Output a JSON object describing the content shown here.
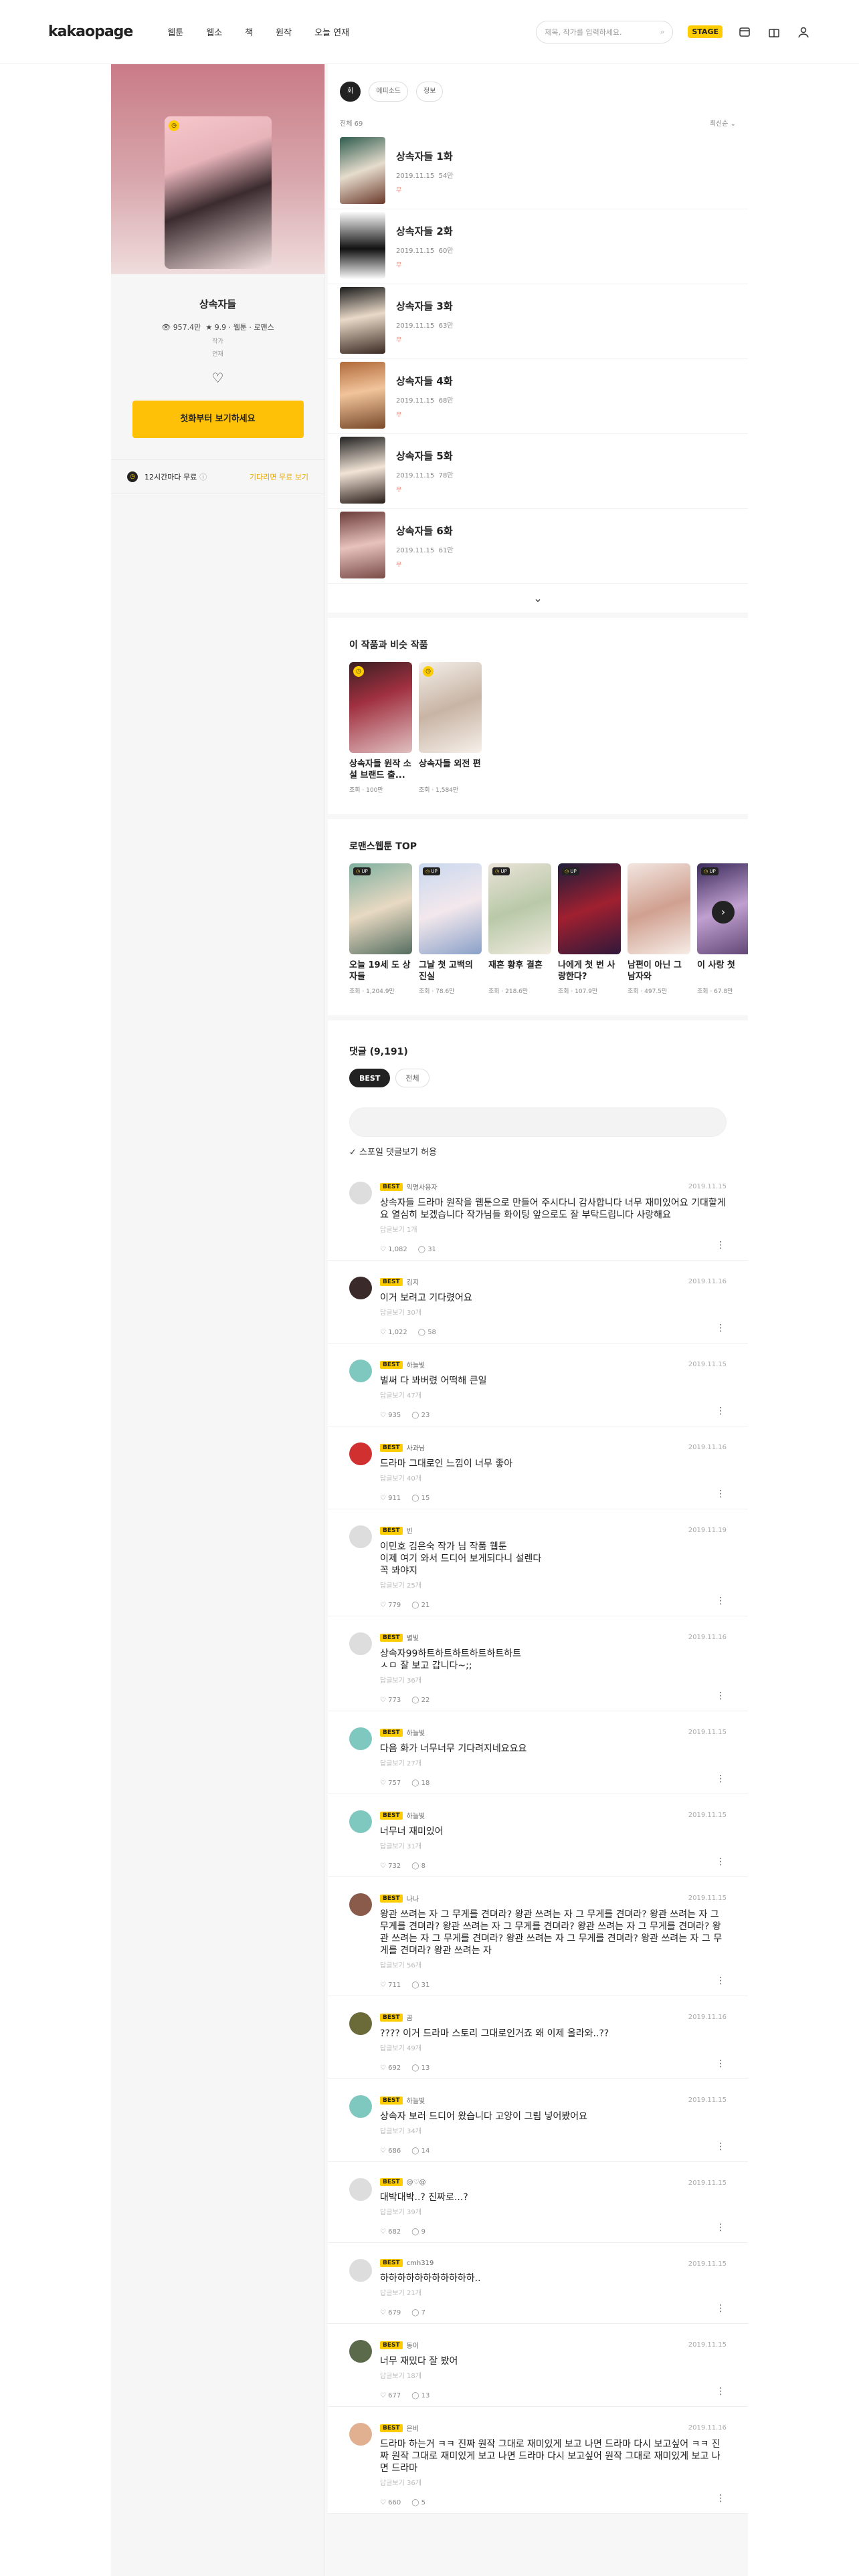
{
  "header": {
    "logo": "kakaopage",
    "nav": [
      "웹툰",
      "웹소",
      "책",
      "원작",
      "오늘 연재"
    ],
    "search_placeholder": "제목, 작가를 입력하세요.",
    "stage": "STAGE"
  },
  "work": {
    "title": "상속자들",
    "views": "957.4만",
    "rating": "9.9",
    "meta": "웹툰 · 로맨스",
    "small1": "작가",
    "small2": "연재",
    "read_button": "첫화부터 보기하세요",
    "wait_text": "12시간마다 무료",
    "wait_link": "기다리면 무료 보기"
  },
  "tabs": [
    "회",
    "에피소드",
    "정보"
  ],
  "episode_header": {
    "count": "전체 69",
    "sort": "최신순"
  },
  "episodes": [
    {
      "title": "상속자들 1화",
      "date": "2019.11.15",
      "views": "54만",
      "zero": "무"
    },
    {
      "title": "상속자들 2화",
      "date": "2019.11.15",
      "views": "60만",
      "zero": "무"
    },
    {
      "title": "상속자들 3화",
      "date": "2019.11.15",
      "views": "63만",
      "zero": "무"
    },
    {
      "title": "상속자들 4화",
      "date": "2019.11.15",
      "views": "68만",
      "zero": "무"
    },
    {
      "title": "상속자들 5화",
      "date": "2019.11.15",
      "views": "78만",
      "zero": "무"
    },
    {
      "title": "상속자들 6화",
      "date": "2019.11.15",
      "views": "61만",
      "zero": "무"
    }
  ],
  "related": {
    "title": "이 작품과 비슷 작품",
    "cards": [
      {
        "title": "상속자들 원작 소설 브랜드 출...",
        "views": "조회 · 100만"
      },
      {
        "title": "상속자들 외전 편",
        "views": "조회 · 1,584만"
      }
    ]
  },
  "top": {
    "title": "로맨스웹툰 TOP",
    "cards": [
      {
        "title": "오늘 19세 도 상자들",
        "views": "조회 · 1,204.9만"
      },
      {
        "title": "그날 첫 고백의 진실",
        "views": "조회 · 78.6만"
      },
      {
        "title": "재혼 황후 결혼",
        "views": "조회 · 218.6만"
      },
      {
        "title": "나에게 첫 번 사랑한다?",
        "views": "조회 · 107.9만"
      },
      {
        "title": "남편이 아닌 그 남자와",
        "views": "조회 · 497.5만"
      },
      {
        "title": "이 사랑 첫",
        "views": "조회 · 67.8만"
      }
    ]
  },
  "comments_section": {
    "title": "댓글 (9,191)",
    "tab_best": "BEST",
    "tab_all": "전체",
    "spoiler": "스포일 댓글보기 허용"
  },
  "comments": [
    {
      "user": "익명사용자",
      "date": "2019.11.15",
      "text": "상속자들 드라마 원작을 웹툰으로 만들어 주시다니 감사합니다 너무 재미있어요 기대할게요 열심히 보겠습니다 작가님들 화이팅 앞으로도 잘 부탁드립니다 사랑해요",
      "reply": "답글보기 1개",
      "likes": "1,082",
      "replies": "31"
    },
    {
      "user": "김지",
      "date": "2019.11.16",
      "text": "이거 보려고 기다렸어요",
      "reply": "답글보기 30개",
      "likes": "1,022",
      "replies": "58"
    },
    {
      "user": "하늘빛",
      "date": "2019.11.15",
      "text": "벌써 다 봐버렸 어떡해 큰일",
      "reply": "답글보기 47개",
      "likes": "935",
      "replies": "23"
    },
    {
      "user": "사과님",
      "date": "2019.11.16",
      "text": "드라마 그대로인 느낌이 너무 좋아",
      "reply": "답글보기 40개",
      "likes": "911",
      "replies": "15"
    },
    {
      "user": "빈",
      "date": "2019.11.19",
      "text": "이민호 김은숙 작가 님 작품 웹툰\n이제 여기 와서 드디어 보게되다니 설렌다\n꼭 봐야지",
      "reply": "답글보기 25개",
      "likes": "779",
      "replies": "21"
    },
    {
      "user": "별빛",
      "date": "2019.11.16",
      "text": "상속자99하트하트하트하트하트하트\nㅅㅁ 잘 보고 갑니다~;;",
      "reply": "답글보기 36개",
      "likes": "773",
      "replies": "22"
    },
    {
      "user": "하늘빛",
      "date": "2019.11.15",
      "text": "다음 화가 너무너무 기다려지네요요요",
      "reply": "답글보기 27개",
      "likes": "757",
      "replies": "18"
    },
    {
      "user": "하늘빛",
      "date": "2019.11.15",
      "text": "너무너 재미있어",
      "reply": "답글보기 31개",
      "likes": "732",
      "replies": "8"
    },
    {
      "user": "나나",
      "date": "2019.11.15",
      "text": "왕관 쓰려는 자 그 무게를 견뎌라? 왕관 쓰려는 자 그 무게를 견뎌라? 왕관 쓰려는 자 그 무게를 견뎌라? 왕관 쓰려는 자 그 무게를 견뎌라? 왕관 쓰려는 자 그 무게를 견뎌라? 왕관 쓰려는 자 그 무게를 견뎌라? 왕관 쓰려는 자 그 무게를 견뎌라? 왕관 쓰려는 자 그 무게를 견뎌라? 왕관 쓰려는 자",
      "reply": "답글보기 56개",
      "likes": "711",
      "replies": "31"
    },
    {
      "user": "곰",
      "date": "2019.11.16",
      "text": "???? 이거 드라마 스토리 그대로인거죠 왜 이제 올라와..??",
      "reply": "답글보기 49개",
      "likes": "692",
      "replies": "13"
    },
    {
      "user": "하늘빛",
      "date": "2019.11.15",
      "text": "상속자 보러 드디어 왔습니다 고양이 그림 넣어봤어요",
      "reply": "답글보기 34개",
      "likes": "686",
      "replies": "14"
    },
    {
      "user": "@♡@",
      "date": "2019.11.15",
      "text": "대박대박..? 진짜로...?",
      "reply": "답글보기 39개",
      "likes": "682",
      "replies": "9"
    },
    {
      "user": "cmh319",
      "date": "2019.11.15",
      "text": "하하하하하하하하하하하..",
      "reply": "답글보기 21개",
      "likes": "679",
      "replies": "7"
    },
    {
      "user": "동이",
      "date": "2019.11.15",
      "text": "너무 재밌다 잘 봤어",
      "reply": "답글보기 18개",
      "likes": "677",
      "replies": "13"
    },
    {
      "user": "은비",
      "date": "2019.11.16",
      "text": "드라마 하는거 ㅋㅋ 진짜 원작 그대로 재미있게 보고 나면 드라마 다시 보고싶어 ㅋㅋ 진짜 원작 그대로 재미있게 보고 나면 드라마 다시 보고싶어 원작 그대로 재미있게 보고 나면 드라마",
      "reply": "답글보기 36개",
      "likes": "660",
      "replies": "5"
    }
  ],
  "colors": {
    "accent": "#ffc107",
    "dark": "#222222"
  }
}
